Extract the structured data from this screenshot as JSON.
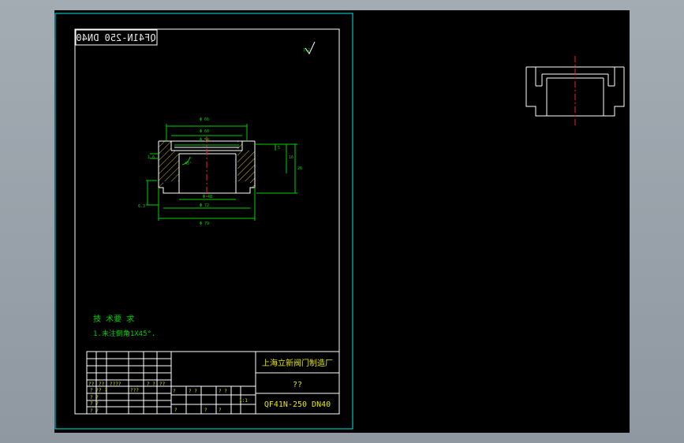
{
  "colors": {
    "background": "#000000",
    "frame": "#00e5e5",
    "outline": "#ffffff",
    "dimension": "#00d000",
    "centerline": "#ff2020",
    "title_text": "#e6e600",
    "note_text": "#00d000"
  },
  "drawing": {
    "part_code_mirrored": "QF41N-250 DN40",
    "roughness_symbol": "3.2",
    "tech_requirements": {
      "heading": "技 术要 求",
      "item_1": "1.未注倒角1X45°."
    },
    "title_block": {
      "company": "上海立新阀门制造厂",
      "part_name": "??",
      "part_code": "QF41N-250 DN40",
      "scale": "1:1",
      "marks": [
        "??",
        "??",
        "????",
        "? ?",
        "??",
        "? ?",
        "? ?",
        "???",
        "? ?",
        "? ?",
        "? ?",
        "?",
        "? ?",
        "? ?",
        "?",
        "?",
        "?"
      ]
    },
    "dimensions": {
      "d_outer_top": "Φ 66",
      "d_inner_top": "Φ 60",
      "d_step": "Φ 54",
      "d_bore": "Φ 48",
      "d_bottom": "Φ 72",
      "d_base": "Φ 79",
      "h_1": "5",
      "h_2": "16",
      "h_3": "26",
      "h_left": "6.3",
      "angle": "45°",
      "chamfer": "1.6"
    }
  }
}
